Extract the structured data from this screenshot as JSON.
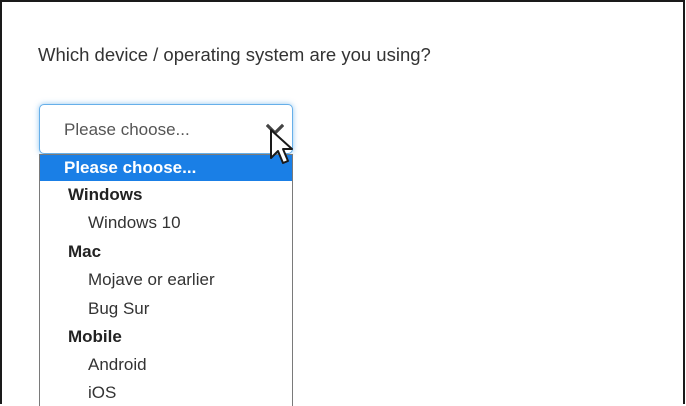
{
  "question": {
    "text": "Which device / operating system are you using?"
  },
  "select": {
    "value": "Please choose...",
    "open": true
  },
  "dropdown": {
    "options": [
      {
        "label": "Please choose...",
        "kind": "option",
        "selected": true
      },
      {
        "label": "Windows",
        "kind": "group"
      },
      {
        "label": "Windows 10",
        "kind": "option"
      },
      {
        "label": "Mac",
        "kind": "group"
      },
      {
        "label": "Mojave or earlier",
        "kind": "option"
      },
      {
        "label": "Bug Sur",
        "kind": "option"
      },
      {
        "label": "Mobile",
        "kind": "group"
      },
      {
        "label": "Android",
        "kind": "option"
      },
      {
        "label": "iOS",
        "kind": "option"
      }
    ]
  },
  "colors": {
    "highlight": "#1a7fe6",
    "focus_border": "#66afe9",
    "text": "#333333"
  },
  "icons": {
    "select_arrow": "chevron-down-icon",
    "pointer": "mouse-cursor-icon"
  }
}
